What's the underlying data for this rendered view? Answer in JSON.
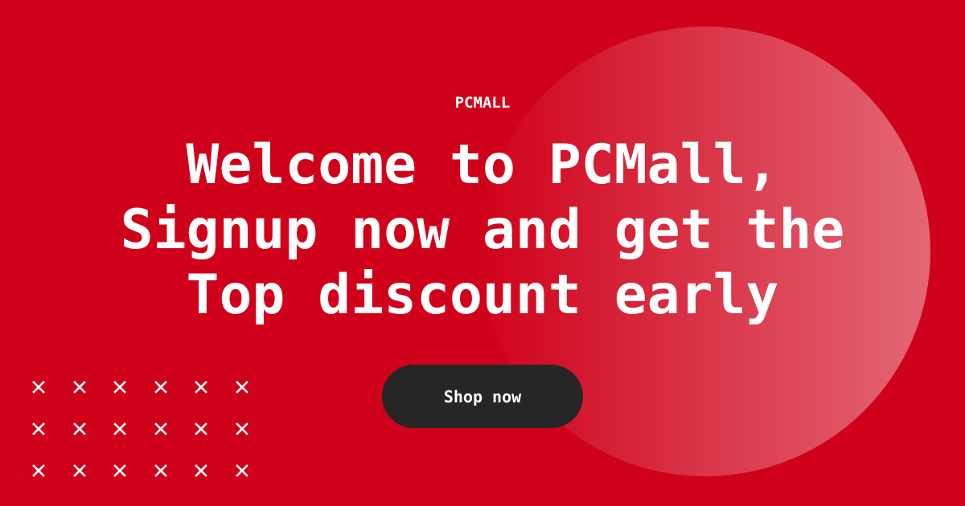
{
  "banner": {
    "brand": "PCMALL",
    "headline_lines": [
      "Welcome to PCMall,",
      "Signup now and get the",
      "Top discount early"
    ],
    "cta_label": "Shop now"
  },
  "decoration": {
    "pattern_icon": "x-mark-icon",
    "pattern_rows": 3,
    "pattern_cols": 6
  },
  "colors": {
    "background": "#d0021b",
    "text": "#ffffff",
    "button": "#262626"
  }
}
